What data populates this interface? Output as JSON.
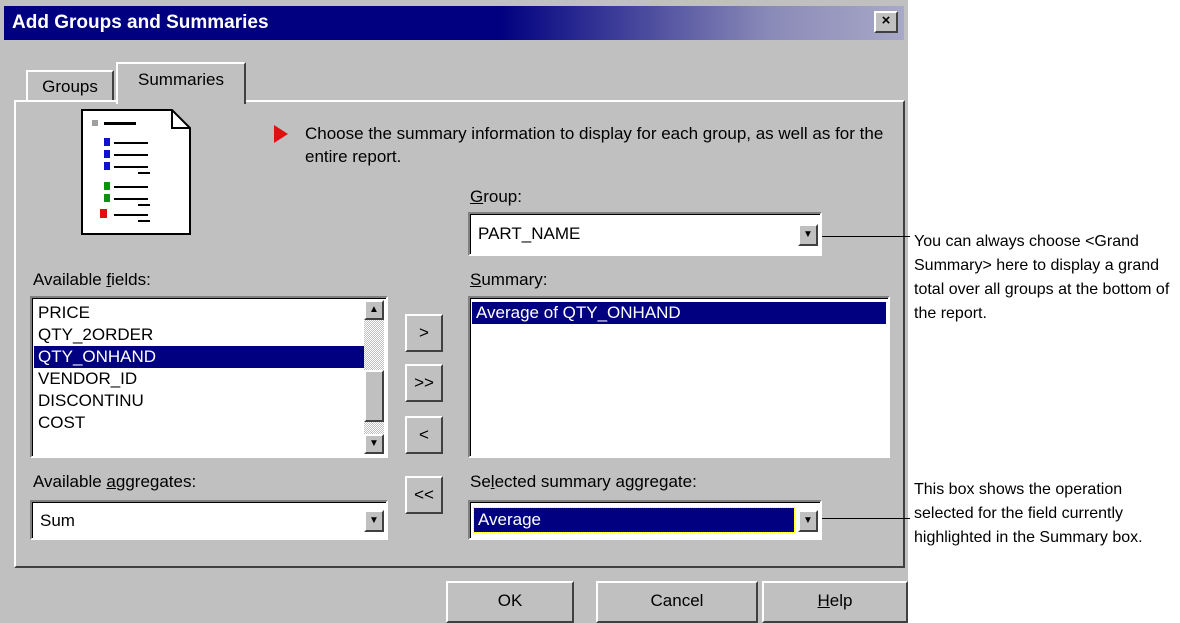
{
  "window": {
    "title": "Add Groups and Summaries",
    "close_glyph": "×"
  },
  "tabs": [
    {
      "label": "Groups"
    },
    {
      "label": "Summaries"
    }
  ],
  "instruction": "Choose the summary information to display for each group, as well as for the entire report.",
  "available_fields": {
    "label_pre": "Available ",
    "label_u": "f",
    "label_post": "ields:",
    "items": [
      "PRICE",
      "QTY_2ORDER",
      "QTY_ONHAND",
      "VENDOR_ID",
      "DISCONTINU",
      "COST"
    ],
    "selected_index": 2
  },
  "available_aggregates": {
    "label_pre": "Available ",
    "label_u": "a",
    "label_post": "ggregates:",
    "value": "Sum"
  },
  "group": {
    "label_u": "G",
    "label_post": "roup:",
    "value": "PART_NAME"
  },
  "summary": {
    "label_u": "S",
    "label_post": "ummary:",
    "items": [
      "Average of QTY_ONHAND"
    ],
    "selected_index": 0
  },
  "selected_summary_aggregate": {
    "label_pre": "Se",
    "label_u": "l",
    "label_post": "ected summary aggregate:",
    "value": "Average"
  },
  "move_buttons": {
    "add": ">",
    "add_all": ">>",
    "remove": "<",
    "remove_all": "<<"
  },
  "footer_buttons": {
    "ok": "OK",
    "cancel": "Cancel",
    "help_u": "H",
    "help_post": "elp"
  },
  "annotations": {
    "group_note": "You can always choose <Grand Summary> here to display a grand total over all groups at the bottom of the report.",
    "aggregate_note": "This box shows the operation selected for the field currently highlighted in the Summary box."
  },
  "colors": {
    "selection": "#000080",
    "dialog": "#c0c0c0",
    "arrow": "#e01010"
  }
}
